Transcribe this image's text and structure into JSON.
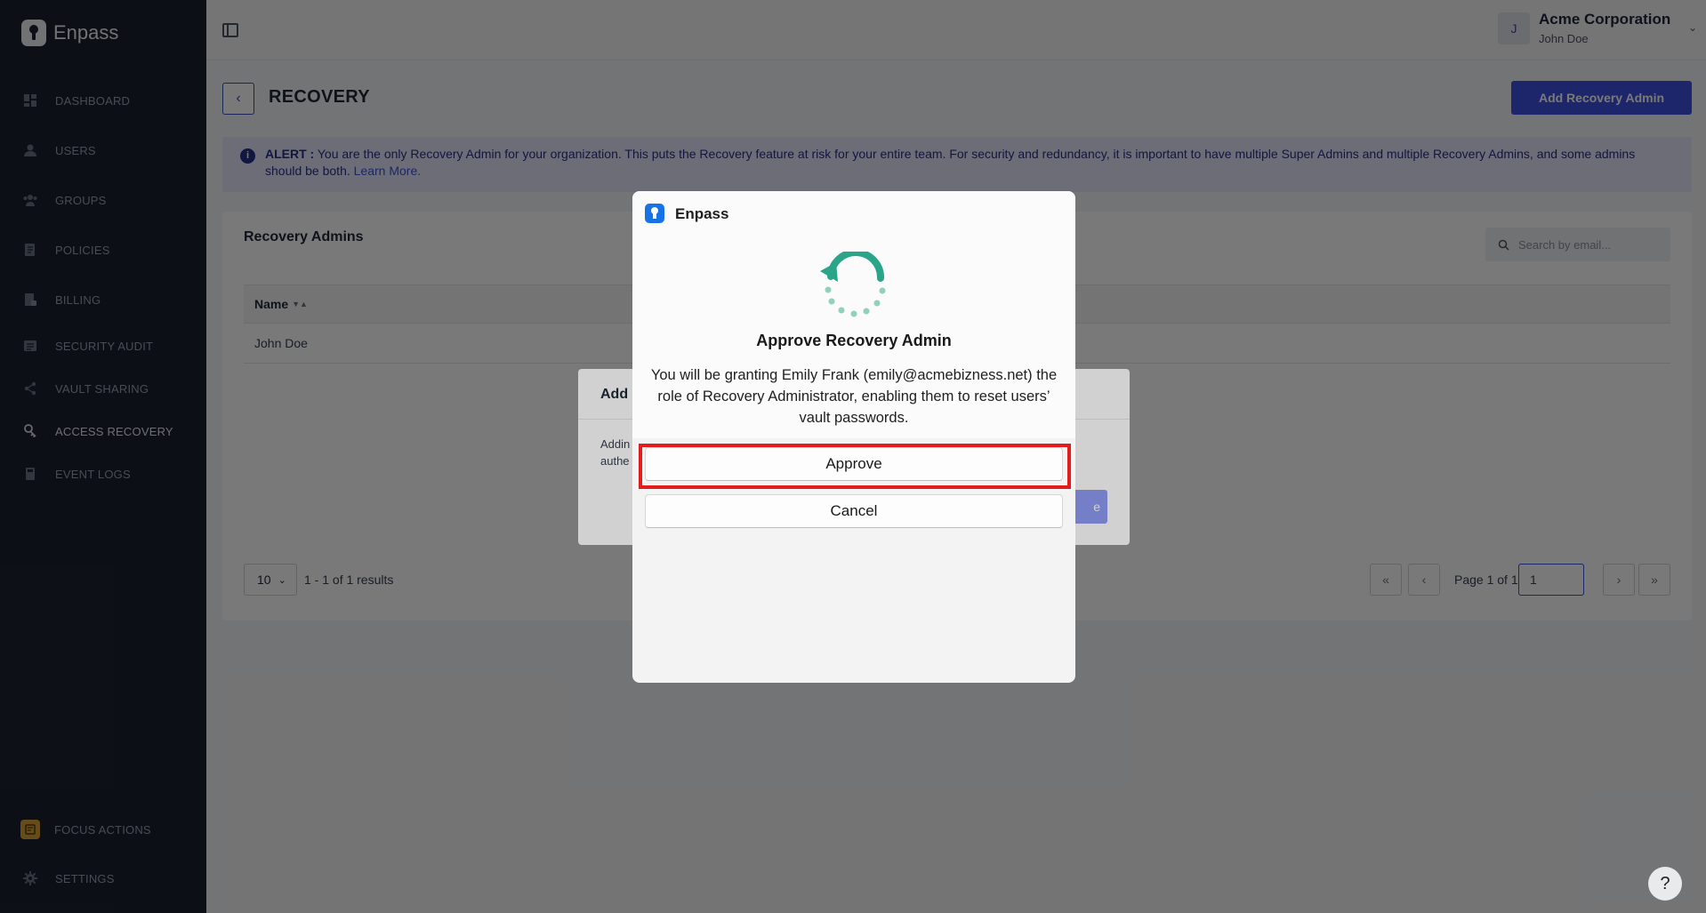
{
  "app": {
    "name": "Enpass"
  },
  "sidebar": {
    "items": [
      {
        "label": "DASHBOARD",
        "icon": "dashboard-icon"
      },
      {
        "label": "USERS",
        "icon": "user-icon"
      },
      {
        "label": "GROUPS",
        "icon": "group-icon"
      },
      {
        "label": "POLICIES",
        "icon": "policy-icon"
      },
      {
        "label": "BILLING",
        "icon": "billing-icon"
      },
      {
        "label": "SECURITY AUDIT",
        "icon": "audit-icon"
      },
      {
        "label": "VAULT SHARING",
        "icon": "share-icon"
      },
      {
        "label": "ACCESS RECOVERY",
        "icon": "key-icon",
        "active": true
      },
      {
        "label": "EVENT LOGS",
        "icon": "log-icon"
      }
    ],
    "bottom": [
      {
        "label": "FOCUS ACTIONS",
        "icon": "focus-actions-icon"
      },
      {
        "label": "SETTINGS",
        "icon": "gear-icon"
      }
    ]
  },
  "topbar": {
    "avatar_initial": "J",
    "org_name": "Acme Corporation",
    "user_name": "John Doe"
  },
  "page": {
    "title": "RECOVERY",
    "primary_button": "Add Recovery Admin"
  },
  "alert": {
    "label": "ALERT :",
    "text": "You are the only Recovery Admin for your organization. This puts the Recovery feature at risk for your entire team. For security and redundancy, it is important to have multiple Super Admins and multiple Recovery Admins, and some admins should be both.",
    "link": "Learn More."
  },
  "card": {
    "title": "Recovery Admins",
    "search_placeholder": "Search by email...",
    "columns": [
      "Name"
    ],
    "rows": [
      [
        "John Doe"
      ]
    ],
    "page_size": "10",
    "results": "1 - 1 of 1 results",
    "page_info": "Page 1 of 1",
    "current_page": "1"
  },
  "bg_modal": {
    "title": "Add",
    "text_line1": "Addin",
    "text_line2": "authe",
    "button": "e"
  },
  "dialog": {
    "app_name": "Enpass",
    "heading": "Approve Recovery Admin",
    "body": "You will be granting Emily Frank (emily@acmebizness.net) the role of Recovery Administrator, enabling them to reset users’ vault passwords.",
    "approve": "Approve",
    "cancel": "Cancel"
  },
  "help": {
    "label": "?"
  },
  "colors": {
    "sidebar_bg": "#1b2130",
    "accent": "#3f51e0",
    "highlight": "#e11d1d",
    "recovery_graphic": "#2aa58a"
  }
}
